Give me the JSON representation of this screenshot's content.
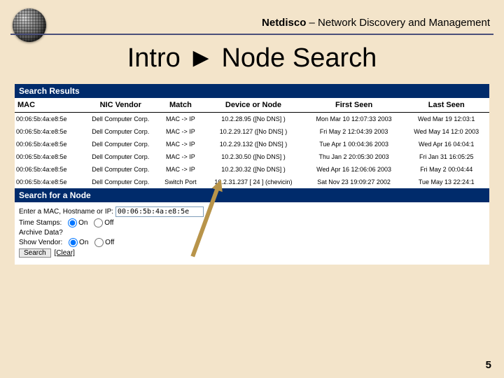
{
  "header": {
    "brand": "Netdisco",
    "tagline": " – Network Discovery and Management"
  },
  "title": "Intro ► Node Search",
  "results_header": "Search Results",
  "columns": [
    "MAC",
    "NIC Vendor",
    "Match",
    "Device or Node",
    "First Seen",
    "Last Seen"
  ],
  "rows": [
    {
      "mac": "00:06:5b:4a:e8:5e",
      "vendor": "Dell Computer Corp.",
      "match": "MAC -> IP",
      "node": "10.2.28.95 ([No DNS] )",
      "first": "Mon Mar 10 12:07:33 2003",
      "last": "Wed Mar 19 12:03:1"
    },
    {
      "mac": "00:06:5b:4a:e8:5e",
      "vendor": "Dell Computer Corp.",
      "match": "MAC -> IP",
      "node": "10.2.29.127 ([No DNS] )",
      "first": "Fri May 2 12:04:39 2003",
      "last": "Wed May 14 12:0\n2003"
    },
    {
      "mac": "00:06:5b:4a:e8:5e",
      "vendor": "Dell Computer Corp.",
      "match": "MAC -> IP",
      "node": "10.2.29.132 ([No DNS] )",
      "first": "Tue Apr 1 00:04:36 2003",
      "last": "Wed Apr 16 04:04:1"
    },
    {
      "mac": "00:06:5b:4a:e8:5e",
      "vendor": "Dell Computer Corp.",
      "match": "MAC -> IP",
      "node": "10.2.30.50 ([No DNS] )",
      "first": "Thu Jan 2 20:05:30 2003",
      "last": "Fri Jan 31 16:05:25"
    },
    {
      "mac": "00:06:5b:4a:e8:5e",
      "vendor": "Dell Computer Corp.",
      "match": "MAC -> IP",
      "node": "10.2.30.32 ([No DNS] )",
      "first": "Wed Apr 16 12:06:06 2003",
      "last": "Fri May 2 00:04:44"
    },
    {
      "mac": "00:06:5b:4a:e8:5e",
      "vendor": "Dell Computer Corp.",
      "match": "Switch Port",
      "node": "10.2.31.237 [ 24 ] (chevicin)",
      "first": "Sat Nov 23 19:09:27 2002",
      "last": "Tue May 13 22:24:1"
    }
  ],
  "search_header": "Search for a Node",
  "form": {
    "prompt": "Enter a MAC, Hostname or IP:",
    "input_value": "00:06:5b:4a:e8:5e",
    "timestamps_label": "Time Stamps:",
    "archive_label": "Archive Data?",
    "vendor_label": "Show Vendor:",
    "on": "On",
    "off": "Off",
    "search_btn": "Search",
    "clear": "[Clear]"
  },
  "page_number": "5"
}
